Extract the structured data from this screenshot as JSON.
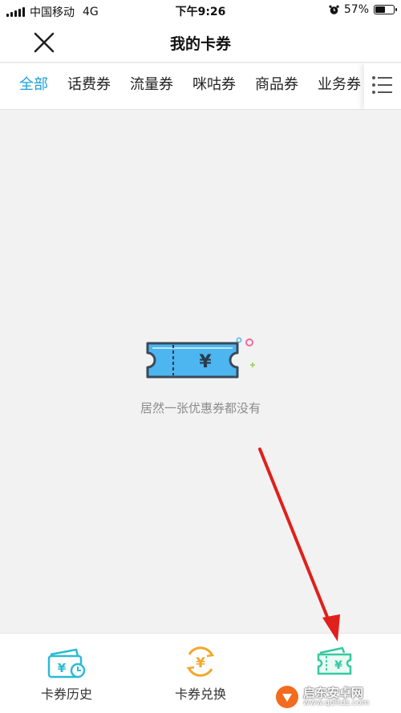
{
  "status_bar": {
    "carrier": "中国移动",
    "network": "4G",
    "time": "下午9:26",
    "battery": "57%",
    "battery_level": 0.57
  },
  "nav": {
    "title": "我的卡券",
    "close_icon": "close-icon"
  },
  "tabs": [
    {
      "label": "全部",
      "active": true
    },
    {
      "label": "话费券",
      "active": false
    },
    {
      "label": "流量券",
      "active": false
    },
    {
      "label": "咪咕券",
      "active": false
    },
    {
      "label": "商品券",
      "active": false
    },
    {
      "label": "业务券",
      "active": false
    }
  ],
  "tabs_menu_icon": "list-menu-icon",
  "empty_state": {
    "icon": "coupon-ticket-icon",
    "currency_symbol": "¥",
    "message": "居然一张优惠券都没有"
  },
  "bottom_nav": [
    {
      "label": "卡券历史",
      "icon": "coupon-history-icon"
    },
    {
      "label": "卡券兑换",
      "icon": "coupon-exchange-icon"
    },
    {
      "label": "",
      "icon": "coupon-wallet-icon"
    }
  ],
  "colors": {
    "accent": "#1a9fd6",
    "ticket_blue": "#4db5ef",
    "ticket_outline": "#3a4a5a",
    "arrow_red": "#e0201b",
    "history_teal": "#2bbbd3",
    "exchange_orange": "#f2a72b",
    "wallet_green": "#36c9a0"
  },
  "watermark": {
    "text": "启东安卓网",
    "url": "www.qdltdz.com"
  }
}
